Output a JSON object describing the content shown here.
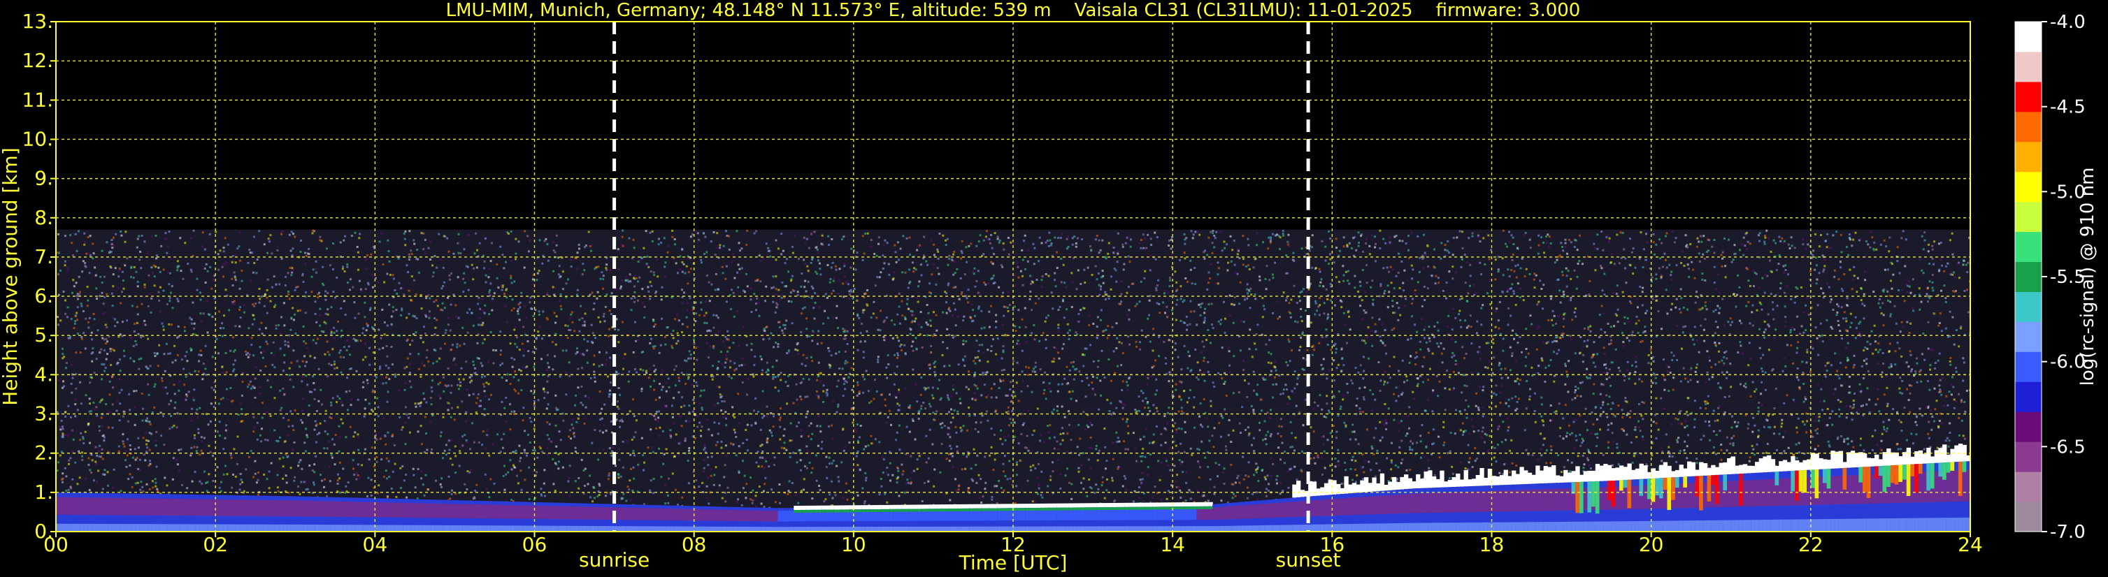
{
  "header": {
    "title": "LMU-MIM, Munich, Germany; 48.148° N 11.573° E, altitude: 539 m    Vaisala CL31 (CL31LMU): 11-01-2025    firmware: 3.000"
  },
  "chart_data": {
    "type": "heatmap",
    "title": "LMU-MIM, Munich, Germany; 48.148° N 11.573° E, altitude: 539 m    Vaisala CL31 (CL31LMU): 11-01-2025    firmware: 3.000",
    "xlabel": "Time [UTC]",
    "ylabel": "Height above ground [km]",
    "xlim": [
      0,
      24
    ],
    "ylim": [
      0,
      13
    ],
    "x_ticks": [
      "00",
      "02",
      "04",
      "06",
      "08",
      "10",
      "12",
      "14",
      "16",
      "18",
      "20",
      "22",
      "24"
    ],
    "y_ticks": [
      "0.",
      "1.",
      "2.",
      "3.",
      "4.",
      "5.",
      "6.",
      "7.",
      "8.",
      "9.",
      "10.",
      "11.",
      "12.",
      "13."
    ],
    "grid": true,
    "events": [
      {
        "name": "sunrise",
        "time": 7.0
      },
      {
        "name": "sunset",
        "time": 15.7
      }
    ],
    "noise_top_km": 7.7,
    "aerosol_layer": [
      {
        "t": 0,
        "top": 1.0
      },
      {
        "t": 3,
        "top": 0.9
      },
      {
        "t": 6,
        "top": 0.75
      },
      {
        "t": 9,
        "top": 0.6
      },
      {
        "t": 14.5,
        "top": 0.7
      },
      {
        "t": 15.7,
        "top": 0.9
      },
      {
        "t": 17,
        "top": 1.1
      },
      {
        "t": 19.5,
        "top": 1.3
      },
      {
        "t": 24,
        "top": 1.8
      }
    ],
    "colorbar": {
      "label": "log(rc-signal) @ 910 nm",
      "ticks": [
        "-4.0",
        "-4.5",
        "-5.0",
        "-5.5",
        "-6.0",
        "-6.5",
        "-7.0"
      ],
      "range": [
        -7.0,
        -4.0
      ],
      "colors": [
        "#9c8a9c",
        "#b07fa6",
        "#8a3b8f",
        "#6a0d7a",
        "#1f1fd8",
        "#3a5cff",
        "#7aa0ff",
        "#3cc8c8",
        "#18a04a",
        "#38e07a",
        "#c8ff3c",
        "#ffff00",
        "#ffb000",
        "#ff6a00",
        "#ff0000",
        "#f0c8c8",
        "#ffffff"
      ]
    }
  }
}
